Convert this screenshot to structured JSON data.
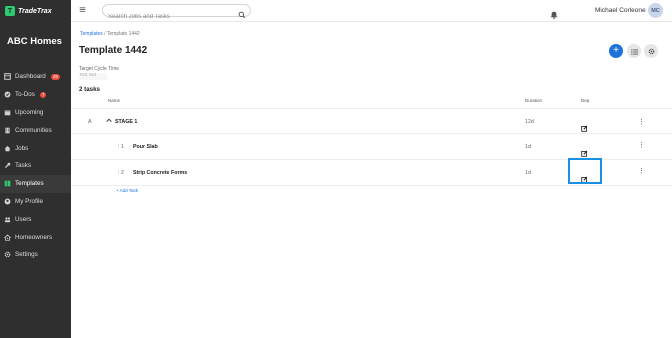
{
  "brand": {
    "name": "TradeTrax",
    "logo_letter": "T",
    "accent": "#2ecc71"
  },
  "company": "ABC Homes",
  "sidebar": {
    "items": [
      {
        "label": "Dashboard",
        "badge": "29",
        "icon": "dashboard-icon"
      },
      {
        "label": "To-Dos",
        "badge": "7",
        "icon": "check-circle-icon"
      },
      {
        "label": "Upcoming",
        "icon": "calendar-icon"
      },
      {
        "label": "Communities",
        "icon": "building-icon"
      },
      {
        "label": "Jobs",
        "icon": "home-icon"
      },
      {
        "label": "Tasks",
        "icon": "wrench-icon"
      },
      {
        "label": "Templates",
        "icon": "template-icon",
        "active": true
      },
      {
        "label": "My Profile",
        "icon": "user-circle-icon"
      },
      {
        "label": "Users",
        "icon": "users-icon"
      },
      {
        "label": "Homeowners",
        "icon": "homeowners-icon"
      },
      {
        "label": "Settings",
        "icon": "gear-icon"
      }
    ]
  },
  "topbar": {
    "search_placeholder": "Search Jobs and Tasks",
    "user_name": "Michael Corleone",
    "avatar_initials": "MC"
  },
  "main": {
    "breadcrumb": {
      "link": "Templates",
      "separator": "/",
      "current": "Template 1442"
    },
    "title": "Template 1442",
    "add_label": "+",
    "cycle_time_label": "Target Cycle Time",
    "cycle_time_placeholder": "Not Set",
    "task_count": "2 tasks",
    "columns": {
      "name": "Name",
      "duration": "Duration",
      "dep": "Dep."
    },
    "rows": [
      {
        "number": "A",
        "name": "STAGE 1",
        "duration": "12d",
        "type": "stage"
      },
      {
        "number": "1",
        "name": "Pour Slab",
        "duration": "1d",
        "type": "task"
      },
      {
        "number": "2",
        "name": "Strip Concrete Forms",
        "duration": "1d",
        "type": "task"
      }
    ],
    "add_task": "+ Add Task"
  },
  "colors": {
    "primary": "#1e73d8",
    "highlight": "#1a8fe3",
    "sidebar_bg": "#2f2f2f"
  }
}
